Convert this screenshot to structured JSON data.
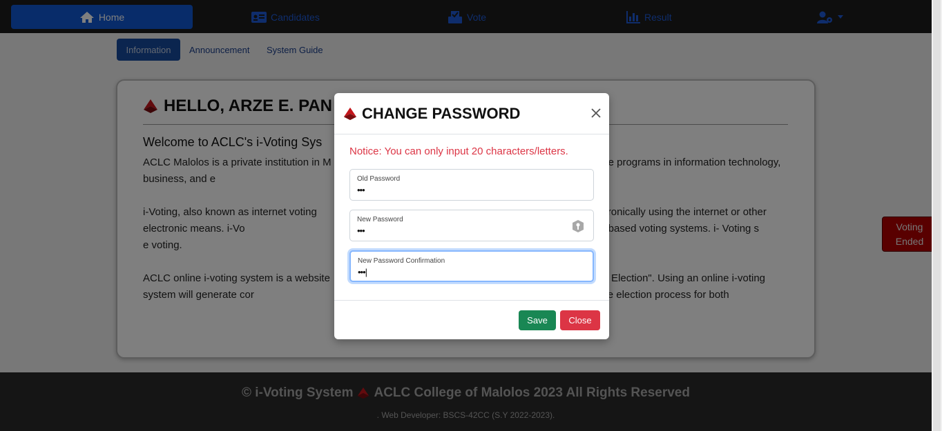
{
  "nav": {
    "home": "Home",
    "candidates": "Candidates",
    "vote": "Vote",
    "result": "Result"
  },
  "tabs": {
    "information": "Information",
    "announcement": "Announcement",
    "system_guide": "System Guide"
  },
  "card": {
    "title": "HELLO, ARZE E. PAN",
    "subtitle": "Welcome to ACLC's i-Voting Sys",
    "paragraph1": "ACLC Malolos is a private institution in M                                                                     uate and graduate programs in information technology, business, and e                                                              n System.",
    "paragraph2": "i-Voting, also known as internet voting                                                                        t their ballots electronically using the internet or other electronic means. i-Vo                                                        untries as an alternative to traditional paper-based voting systems. i- Voting s                                                        e voting.",
    "paragraph3": "ACLC online i-voting system is a website                                                                       \"StudentCouncil Election\". Using an online i-voting system will generate cor                                                      your voting-related costs, and streamline the election process for both"
  },
  "voting_status": "Voting Ended",
  "footer": {
    "main_left": "© i-Voting System",
    "main_right": "ACLC College of Malolos 2023 All Rights Reserved",
    "sub": ". Web Developer: BSCS-42CC (S.Y 2022-2023)."
  },
  "modal": {
    "title": "CHANGE PASSWORD",
    "notice": "Notice: You can only input 20 characters/letters.",
    "fields": [
      {
        "label": "Old Password",
        "value": "•••"
      },
      {
        "label": "New Password",
        "value": "•••"
      },
      {
        "label": "New Password Confirmation",
        "value": "•••|"
      }
    ],
    "save_label": "Save",
    "close_label": "Close"
  },
  "colors": {
    "primary": "#1159d4",
    "danger": "#dc3545",
    "success": "#198754",
    "navbar": "#1c1c1c",
    "voting_ended": "#b30000"
  }
}
